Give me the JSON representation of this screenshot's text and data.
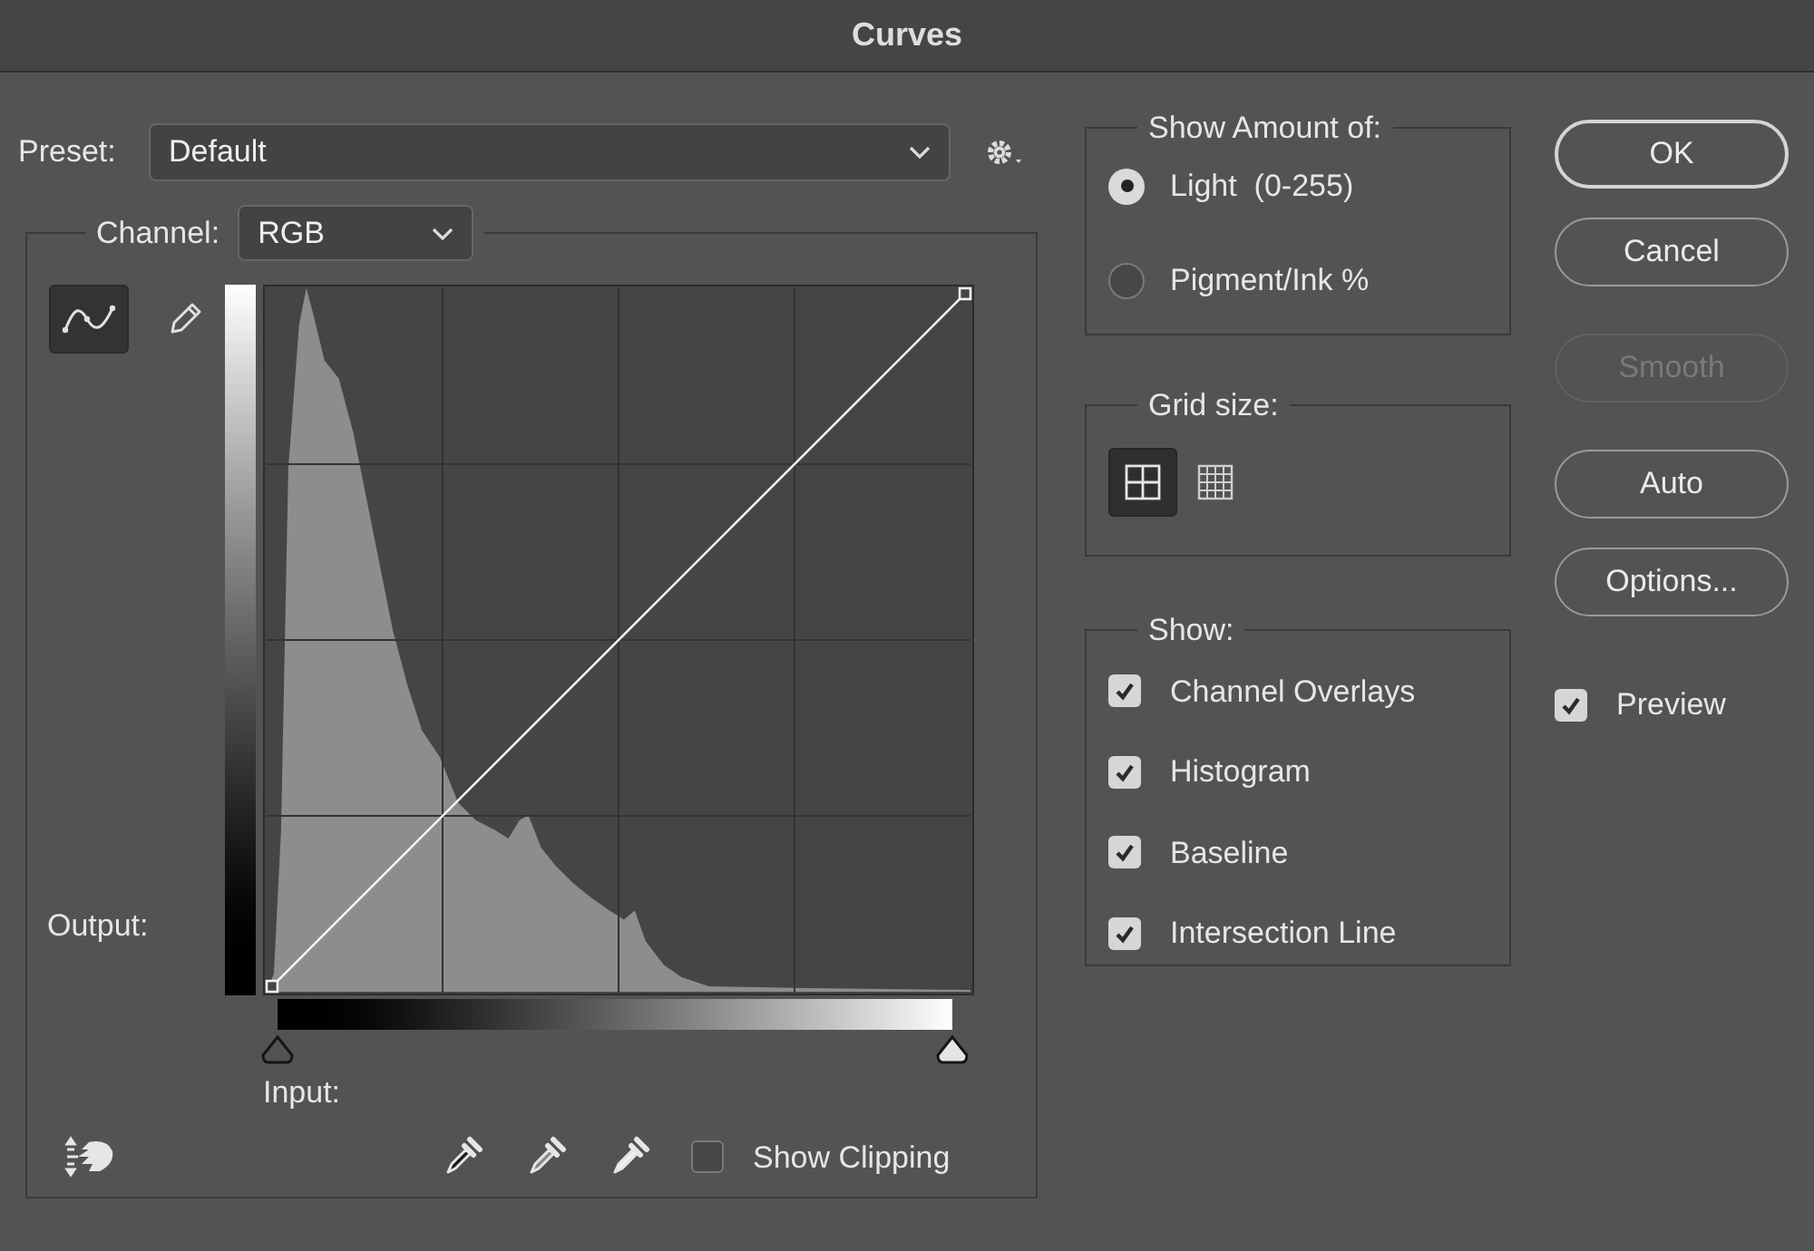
{
  "window": {
    "title": "Curves"
  },
  "preset": {
    "label": "Preset:",
    "value": "Default"
  },
  "channel": {
    "label": "Channel:",
    "value": "RGB"
  },
  "curve_tools": [
    {
      "kind": "curve",
      "selected": true
    },
    {
      "kind": "pencil",
      "selected": false
    }
  ],
  "output_label": "Output:",
  "input_sliders": [
    {
      "kind": "shadow",
      "level": 0
    },
    {
      "kind": "highlight",
      "level": 1
    }
  ],
  "input_label": "Input:",
  "eyedroppers": [
    {
      "kind": "black"
    },
    {
      "kind": "gray"
    },
    {
      "kind": "white"
    }
  ],
  "show_clipping": {
    "label": "Show Clipping",
    "checked": false
  },
  "show_amount": {
    "title": "Show Amount of:",
    "options": [
      {
        "label": "Light  (0-255)",
        "selected": true
      },
      {
        "label": "Pigment/Ink %",
        "selected": false
      }
    ]
  },
  "grid_size": {
    "title": "Grid size:",
    "options": [
      {
        "kind": "coarse",
        "selected": true
      },
      {
        "kind": "fine",
        "selected": false
      }
    ]
  },
  "show": {
    "title": "Show:",
    "items": [
      {
        "label": "Channel Overlays",
        "checked": true
      },
      {
        "label": "Histogram",
        "checked": true
      },
      {
        "label": "Baseline",
        "checked": true
      },
      {
        "label": "Intersection Line",
        "checked": true
      }
    ]
  },
  "buttons": [
    {
      "label": "OK",
      "default": true,
      "disabled": false
    },
    {
      "label": "Cancel",
      "default": false,
      "disabled": false
    },
    {
      "label": "Smooth",
      "default": false,
      "disabled": true
    },
    {
      "label": "Auto",
      "default": false,
      "disabled": false
    },
    {
      "label": "Options...",
      "default": false,
      "disabled": false
    }
  ],
  "preview": {
    "label": "Preview",
    "checked": true
  }
}
